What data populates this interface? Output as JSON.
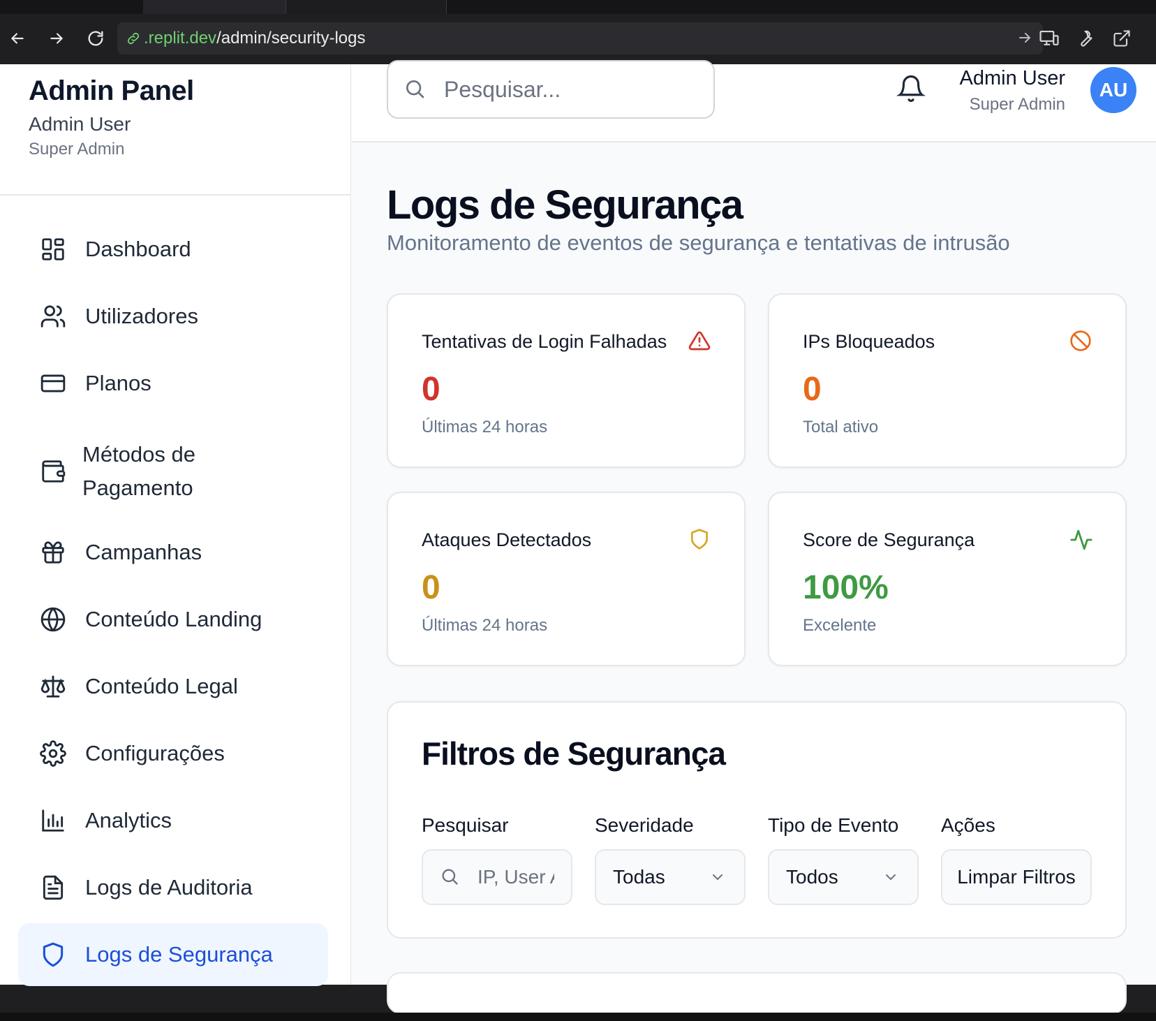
{
  "browser": {
    "url_host": ".replit.dev",
    "url_path": "/admin/security-logs"
  },
  "sidebar": {
    "brand": "Admin Panel",
    "user_name": "Admin User",
    "user_role": "Super Admin",
    "items": [
      {
        "label": "Dashboard",
        "icon": "dashboard-icon"
      },
      {
        "label": "Utilizadores",
        "icon": "users-icon"
      },
      {
        "label": "Planos",
        "icon": "credit-card-icon"
      },
      {
        "label": "Métodos de Pagamento",
        "icon": "wallet-icon"
      },
      {
        "label": "Campanhas",
        "icon": "gift-icon"
      },
      {
        "label": "Conteúdo Landing",
        "icon": "globe-icon"
      },
      {
        "label": "Conteúdo Legal",
        "icon": "scale-icon"
      },
      {
        "label": "Configurações",
        "icon": "gear-icon"
      },
      {
        "label": "Analytics",
        "icon": "bar-chart-icon"
      },
      {
        "label": "Logs de Auditoria",
        "icon": "file-text-icon"
      },
      {
        "label": "Logs de Segurança",
        "icon": "shield-icon",
        "active": true
      }
    ]
  },
  "topbar": {
    "search_placeholder": "Pesquisar...",
    "user_name": "Admin User",
    "user_role": "Super Admin",
    "avatar_initials": "AU"
  },
  "page": {
    "title": "Logs de Segurança",
    "subtitle": "Monitoramento de eventos de segurança e tentativas de intrusão"
  },
  "stats": [
    {
      "title": "Tentativas de Login Falhadas",
      "value": "0",
      "note": "Últimas 24 horas",
      "color": "#d0342c",
      "icon": "alert-triangle-icon"
    },
    {
      "title": "IPs Bloqueados",
      "value": "0",
      "note": "Total ativo",
      "color": "#e8681a",
      "icon": "ban-icon"
    },
    {
      "title": "Ataques Detectados",
      "value": "0",
      "note": "Últimas 24 horas",
      "color": "#c9911a",
      "icon": "shield-icon"
    },
    {
      "title": "Score de Segurança",
      "value": "100%",
      "note": "Excelente",
      "color": "#3f9a43",
      "icon": "activity-icon"
    }
  ],
  "filters": {
    "title": "Filtros de Segurança",
    "search_label": "Pesquisar",
    "search_placeholder": "IP, User Agent...",
    "severity_label": "Severidade",
    "severity_value": "Todas",
    "event_type_label": "Tipo de Evento",
    "event_type_value": "Todos",
    "actions_label": "Ações",
    "clear_button": "Limpar Filtros"
  }
}
